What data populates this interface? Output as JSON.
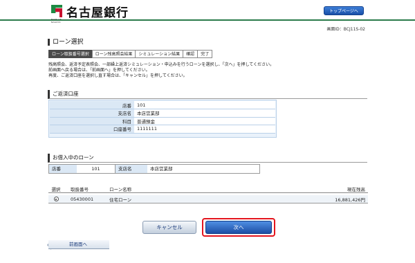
{
  "header": {
    "logo_text": "名古屋銀行",
    "logo_sub": "BANK OF NAGOYA",
    "top_button": "トップページへ"
  },
  "screen_id": "画面ID：BCJ11S-02",
  "page_title": "ローン選択",
  "steps": [
    {
      "label": "ローン取扱番号選択",
      "active": true
    },
    {
      "label": "ローン残高照会結果",
      "active": false
    },
    {
      "label": "シミュレーション結果",
      "active": false
    },
    {
      "label": "確認",
      "active": false
    },
    {
      "label": "完了",
      "active": false
    }
  ],
  "instructions": [
    "残高照会、返済予定表照会、一部繰上返済シミュレーション・申込みを行うローンを選択し、「次へ」を押してください。",
    "前画面へ戻る場合は、「前画面へ」を押してください。",
    "再度、ご返済口座を選択し直す場合は、「キャンセル」を押してください。"
  ],
  "account_section": {
    "title": "ご返済口座",
    "rows": [
      {
        "label": "店番",
        "value": "101"
      },
      {
        "label": "支店名",
        "value": "本店営業部"
      },
      {
        "label": "科目",
        "value": "普通預金"
      },
      {
        "label": "口座番号",
        "value": "1111111"
      }
    ]
  },
  "loan_section": {
    "title": "お借入中のローン",
    "branch_no_label": "店番",
    "branch_no": "101",
    "branch_name_label": "支店名",
    "branch_name": "本店営業部",
    "columns": [
      "選択",
      "取扱番号",
      "ローン名称",
      "現在残高"
    ],
    "rows": [
      {
        "selected": true,
        "number": "05430001",
        "name": "住宅ローン",
        "balance": "16,881,426円"
      }
    ]
  },
  "buttons": {
    "cancel": "キャンセル",
    "next": "次へ",
    "back": "前画面へ"
  }
}
